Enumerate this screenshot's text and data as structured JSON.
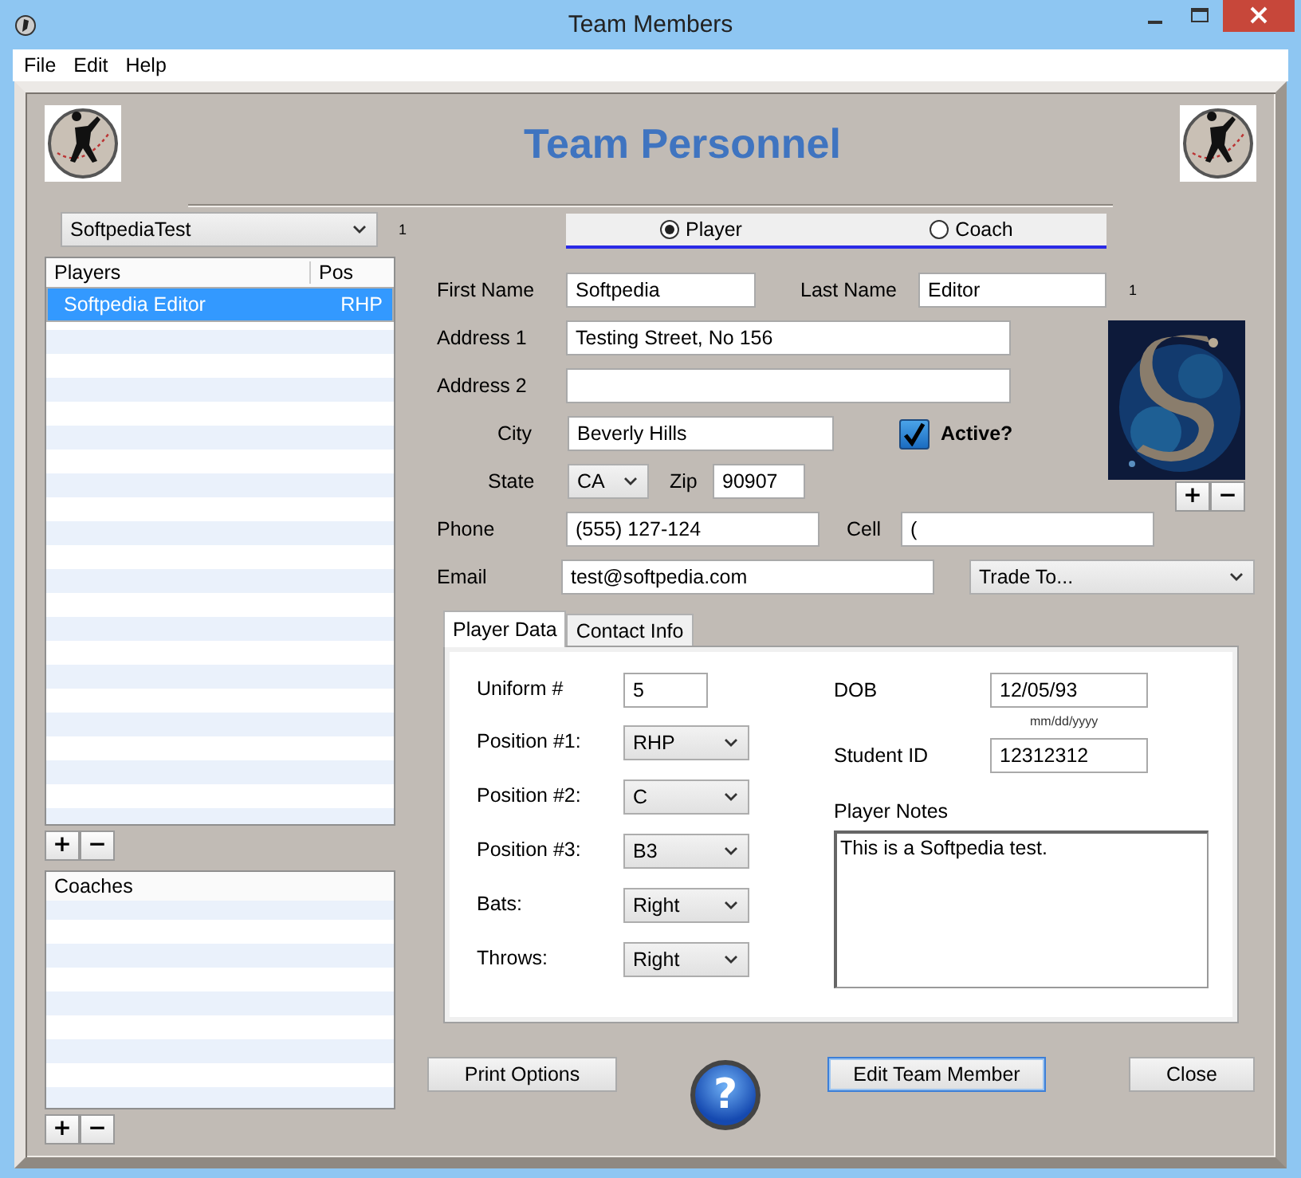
{
  "window": {
    "title": "Team Members"
  },
  "menu": [
    "File",
    "Edit",
    "Help"
  ],
  "header": {
    "title": "Team Personnel"
  },
  "team_select": {
    "value": "SoftpediaTest",
    "count": "1"
  },
  "players": {
    "columns": [
      "Players",
      "Pos"
    ],
    "rows": [
      {
        "name": "Softpedia Editor",
        "pos": "RHP",
        "selected": true
      }
    ],
    "buttons": [
      "+",
      "−"
    ]
  },
  "coaches": {
    "columns": [
      "Coaches"
    ],
    "buttons": [
      "+",
      "−"
    ]
  },
  "role": [
    {
      "label": "Player",
      "selected": true
    },
    {
      "label": "Coach",
      "selected": false
    }
  ],
  "person": {
    "first_name": {
      "label": "First Name",
      "value": "Softpedia"
    },
    "last_name": {
      "label": "Last Name",
      "value": "Editor"
    },
    "record_count": "1",
    "address1": {
      "label": "Address 1",
      "value": "Testing Street, No 156"
    },
    "address2": {
      "label": "Address 2"
    },
    "city": {
      "label": "City",
      "value": "Beverly Hills"
    },
    "active": {
      "label": "Active?",
      "checked": true
    },
    "state": {
      "label": "State",
      "value": "CA"
    },
    "zip": {
      "label": "Zip",
      "value": "90907"
    },
    "phone": {
      "label": "Phone",
      "value": "(555) 127-124"
    },
    "cell": {
      "label": "Cell",
      "value": "("
    },
    "email": {
      "label": "Email",
      "value": "test@softpedia.com"
    },
    "trade": {
      "value": "Trade To..."
    },
    "photo_buttons": [
      "+",
      "−"
    ]
  },
  "tabs": [
    {
      "label": "Player Data",
      "selected": true
    },
    {
      "label": "Contact Info",
      "selected": false
    }
  ],
  "player_data": {
    "uniform": {
      "label": "Uniform #",
      "value": "5"
    },
    "selects": [
      {
        "label": "Position #1:",
        "value": "RHP"
      },
      {
        "label": "Position #2:",
        "value": "C"
      },
      {
        "label": "Position #3:",
        "value": "B3"
      },
      {
        "label": "Bats:",
        "value": "Right"
      },
      {
        "label": "Throws:",
        "value": "Right"
      }
    ],
    "dob": {
      "label": "DOB",
      "value": "12/05/93",
      "hint": "mm/dd/yyyy"
    },
    "student_id": {
      "label": "Student ID",
      "value": "12312312"
    },
    "notes": {
      "label": "Player Notes",
      "value": "This is a Softpedia test."
    }
  },
  "actions": [
    {
      "label": "Print Options",
      "focused": false
    },
    {
      "label": "Edit Team Member",
      "focused": true
    },
    {
      "label": "Close",
      "focused": false
    }
  ],
  "help": "?"
}
